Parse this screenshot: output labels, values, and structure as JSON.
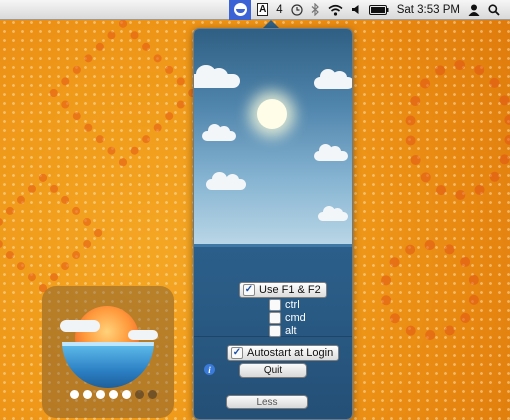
{
  "menubar": {
    "badge_text": "4",
    "clock": "Sat 3:53 PM",
    "icons": [
      "sunshine-app-icon",
      "adobe-icon",
      "time-machine-icon",
      "bluetooth-icon",
      "wifi-icon",
      "volume-icon",
      "battery-icon",
      "user-icon",
      "spotlight-icon"
    ]
  },
  "popover": {
    "use_f1_f2": {
      "label": "Use F1 & F2",
      "checked": true
    },
    "modifiers": [
      {
        "label": "ctrl",
        "checked": false
      },
      {
        "label": "cmd",
        "checked": false
      },
      {
        "label": "alt",
        "checked": false
      }
    ],
    "autostart": {
      "label": "Autostart at Login",
      "checked": true
    },
    "quit_label": "Quit",
    "less_label": "Less",
    "info_symbol": "i"
  },
  "hud": {
    "level": {
      "filled": 5,
      "total": 7
    }
  },
  "colors": {
    "wallpaper": "#f09a1a",
    "menu_highlight": "#3b63d6",
    "sea": "#295a84"
  }
}
